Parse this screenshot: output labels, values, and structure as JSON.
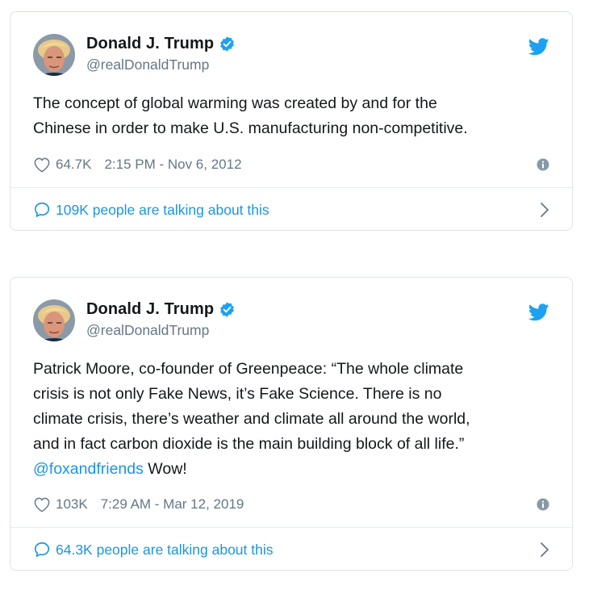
{
  "colors": {
    "link": "#1b95e0",
    "muted": "#657786",
    "text": "#14171a",
    "verified": "#1da1f2",
    "border": "#dfe3e8"
  },
  "tweets": [
    {
      "display_name": "Donald J. Trump",
      "handle": "@realDonaldTrump",
      "verified": true,
      "text_lines": [
        "The concept of global warming was created by and for the",
        "Chinese in order to make U.S. manufacturing non-competitive."
      ],
      "mention": "",
      "after_mention": "",
      "likes": "64.7K",
      "timestamp": "2:15 PM - Nov 6, 2012",
      "talking": "109K people are talking about this",
      "icons": [
        "avatar",
        "verified-badge-icon",
        "twitter-bird-icon",
        "heart-icon",
        "info-icon",
        "speech-bubble-icon",
        "chevron-right-icon"
      ]
    },
    {
      "display_name": "Donald J. Trump",
      "handle": "@realDonaldTrump",
      "verified": true,
      "text_lines": [
        "Patrick Moore, co-founder of Greenpeace: “The whole climate",
        "crisis is not only Fake News, it’s Fake Science. There is no",
        "climate crisis, there’s weather and climate all around the world,",
        "and in fact carbon dioxide is the main building block of all life.”"
      ],
      "mention": "@foxandfriends",
      "after_mention": " Wow!",
      "likes": "103K",
      "timestamp": "7:29 AM - Mar 12, 2019",
      "talking": "64.3K people are talking about this",
      "icons": [
        "avatar",
        "verified-badge-icon",
        "twitter-bird-icon",
        "heart-icon",
        "info-icon",
        "speech-bubble-icon",
        "chevron-right-icon"
      ]
    }
  ]
}
